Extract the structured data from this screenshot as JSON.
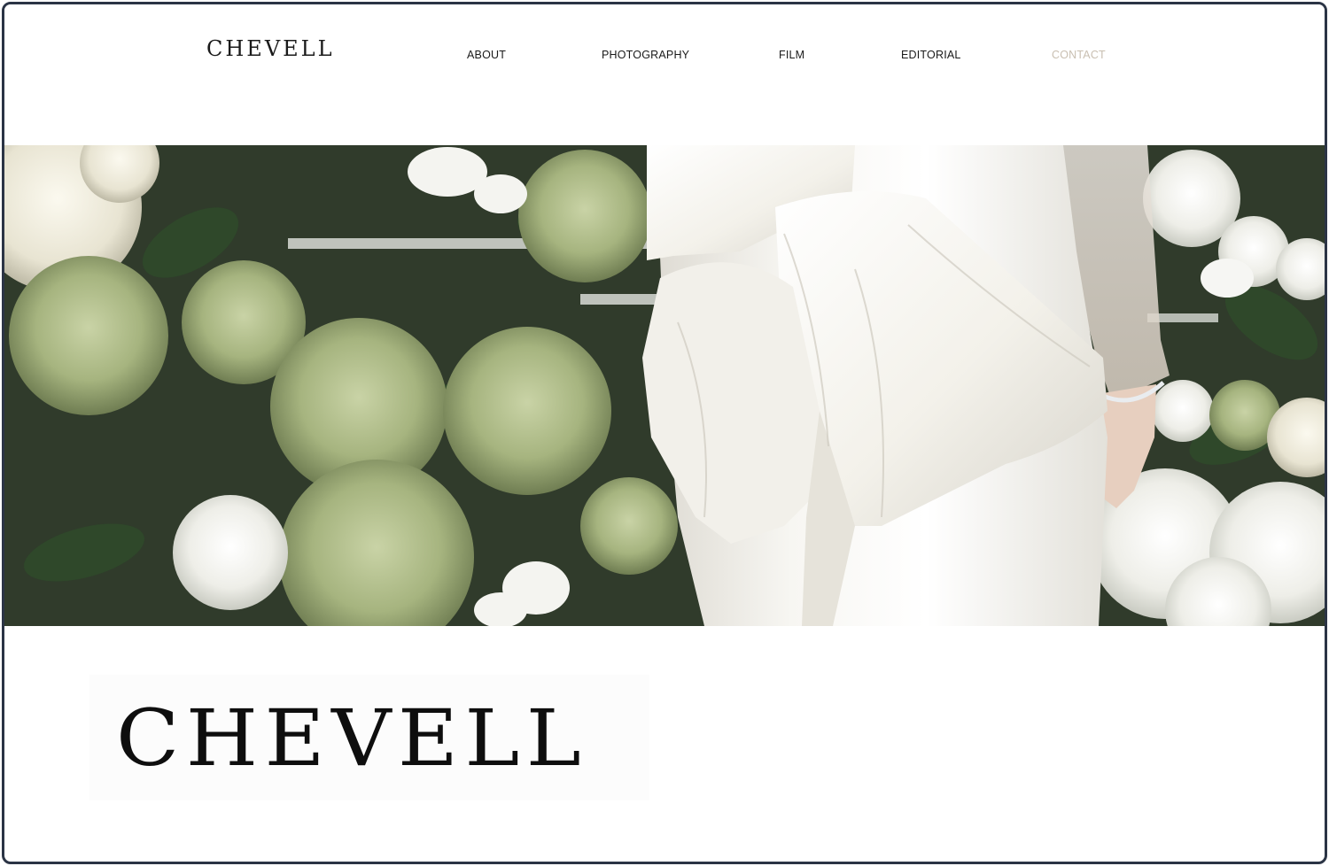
{
  "header": {
    "brand": "CHEVELL",
    "nav": [
      {
        "label": "ABOUT"
      },
      {
        "label": "PHOTOGRAPHY"
      },
      {
        "label": "FILM"
      },
      {
        "label": "EDITORIAL"
      },
      {
        "label": "CONTACT",
        "active": true
      }
    ],
    "active_color": "#c9bfb1"
  },
  "hero": {
    "image": "bride-white-bow-dress-among-hydrangeas",
    "colors": {
      "foliage": "#3d4a35",
      "hydrangea_green": "#a8b882",
      "dress_white": "#f1efe9"
    }
  },
  "footer_logo": {
    "text": "CHEVELL"
  },
  "colors": {
    "frame_border": "#2b3445",
    "text": "#1a1a1a"
  }
}
